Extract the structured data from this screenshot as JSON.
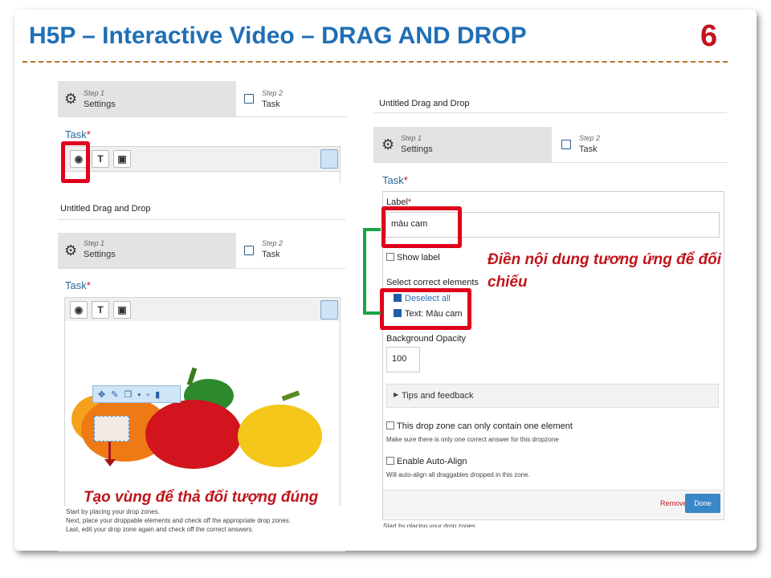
{
  "slide": {
    "title": "H5P – Interactive Video – DRAG AND DROP",
    "page_number": "6"
  },
  "steps": {
    "step1_num": "Step 1",
    "step1_label": "Settings",
    "step2_num": "Step 2",
    "step2_label": "Task"
  },
  "left": {
    "task_heading": "Task",
    "required_mark": "*",
    "toolbar_text_btn": "T",
    "dd_title": "Untitled Drag and Drop",
    "instructions": [
      "Start by placing your drop zones.",
      "Next, place your droppable elements and check off the appropriate drop zones.",
      "Last, edit your drop zone again and check off the correct answers."
    ]
  },
  "right": {
    "dd_title": "Untitled Drag and Drop",
    "task_heading": "Task",
    "required_mark": "*",
    "label_field_label": "Label",
    "label_value": "màu cam",
    "show_label": "Show label",
    "select_correct": "Select correct elements",
    "deselect_all": "Deselect all",
    "text_element": "Text: Màu cam",
    "bg_opacity_label": "Background Opacity",
    "bg_opacity_value": "100",
    "tips_feedback": "Tips and feedback",
    "single_element_label": "This drop zone can only contain one element",
    "single_element_desc": "Make sure there is only one correct answer for this dropzone",
    "auto_align_label": "Enable Auto-Align",
    "auto_align_desc": "Will auto-align all draggables dropped in this zone.",
    "remove": "Remove",
    "done": "Done",
    "footer_text": "Start by placing your drop zones."
  },
  "annotations": {
    "fill_content": "Điền nội dung tương ứng để đối chiếu",
    "create_zone": "Tạo vùng để thả đối tượng đúng"
  },
  "colors": {
    "title": "#1f6fb5",
    "accent_red": "#c0151b",
    "highlight_red": "#e0001b",
    "connector_green": "#1aa34a",
    "done_button": "#3a87c8"
  },
  "icons": [
    "gear-icon",
    "task-box-icon",
    "circle-tool-icon",
    "image-tool-icon",
    "clipboard-icon",
    "move-icon",
    "edit-icon",
    "copy-icon",
    "paste-icon",
    "delete-icon",
    "chevron-right-icon"
  ]
}
